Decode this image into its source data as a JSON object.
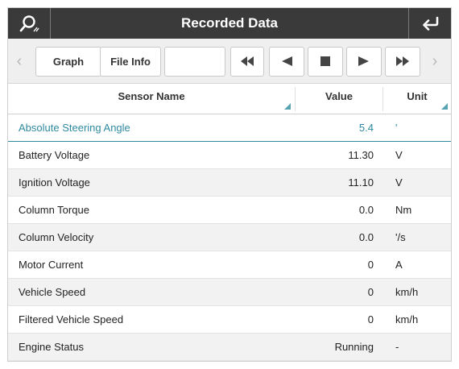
{
  "titlebar": {
    "title": "Recorded Data",
    "left_icon": "search-edit-icon",
    "right_icon": "return-arrow-icon",
    "bg_color": "#3a3a3a"
  },
  "toolbar": {
    "graph_label": "Graph",
    "file_info_label": "File Info",
    "blank_label": "",
    "prev_icon": "chevron-left-icon",
    "rewind_icon": "rewind-icon",
    "step_back_icon": "step-back-icon",
    "stop_icon": "stop-icon",
    "play_icon": "play-icon",
    "fast_forward_icon": "fast-forward-icon",
    "next_icon": "chevron-right-icon"
  },
  "table": {
    "columns": [
      "Sensor Name",
      "Value",
      "Unit"
    ],
    "accent_color": "#2e8aa0",
    "rows": [
      {
        "name": "Absolute Steering Angle",
        "value": "5.4",
        "unit": "'"
      },
      {
        "name": "Battery Voltage",
        "value": "11.30",
        "unit": "V"
      },
      {
        "name": "Ignition Voltage",
        "value": "11.10",
        "unit": "V"
      },
      {
        "name": "Column Torque",
        "value": "0.0",
        "unit": "Nm"
      },
      {
        "name": "Column Velocity",
        "value": "0.0",
        "unit": "'/s"
      },
      {
        "name": "Motor Current",
        "value": "0",
        "unit": "A"
      },
      {
        "name": "Vehicle Speed",
        "value": "0",
        "unit": "km/h"
      },
      {
        "name": "Filtered Vehicle Speed",
        "value": "0",
        "unit": "km/h"
      },
      {
        "name": "Engine Status",
        "value": "Running",
        "unit": "-"
      }
    ]
  }
}
